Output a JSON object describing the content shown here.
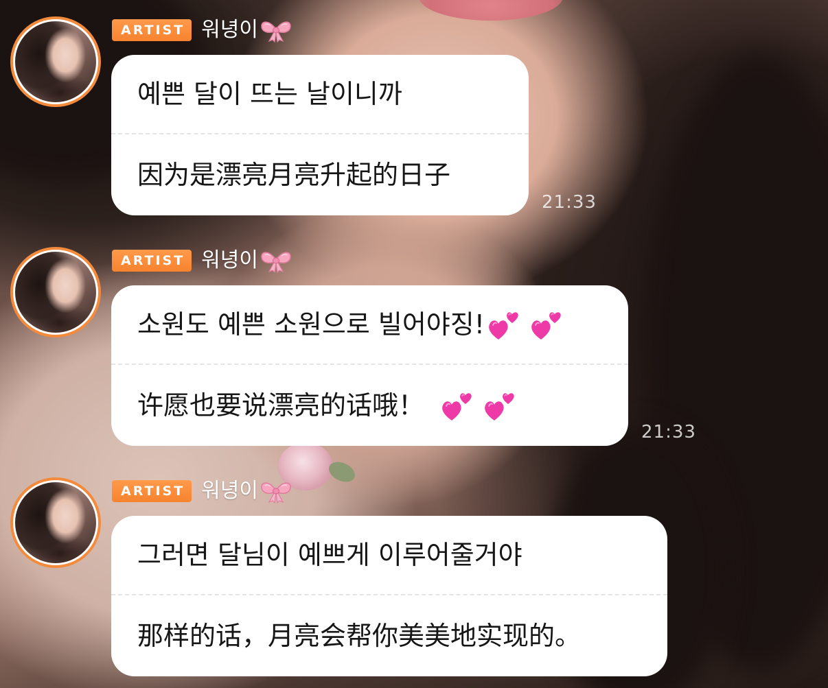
{
  "messages": [
    {
      "badge": "ARTIST",
      "sender": "워녕이",
      "original": "예쁜 달이 뜨는 날이니까",
      "translated": "因为是漂亮月亮升起的日子",
      "time": "21:33",
      "original_emojis": [],
      "translated_emojis": []
    },
    {
      "badge": "ARTIST",
      "sender": "워녕이",
      "original": "소원도 예쁜 소원으로 빌어야징!",
      "translated": "许愿也要说漂亮的话哦！",
      "time": "21:33",
      "original_emojis": [
        "two-hearts-icon",
        "two-hearts-icon"
      ],
      "translated_emojis": [
        "two-hearts-icon",
        "two-hearts-icon"
      ]
    },
    {
      "badge": "ARTIST",
      "sender": "워녕이",
      "original": "그러면 달님이 예쁘게 이루어줄거야",
      "translated": "那样的话，月亮会帮你美美地实现的。",
      "time": "",
      "original_emojis": [],
      "translated_emojis": []
    }
  ],
  "colors": {
    "badge": "#f7832f",
    "avatar_ring": "#f38a3c",
    "bubble": "#ffffff",
    "text": "#161616",
    "timestamp": "#c9c1be",
    "heart": "#ee3aa6"
  },
  "icons": {
    "name_suffix": "ribbon-bow-icon",
    "emoji": "two-hearts-icon"
  }
}
